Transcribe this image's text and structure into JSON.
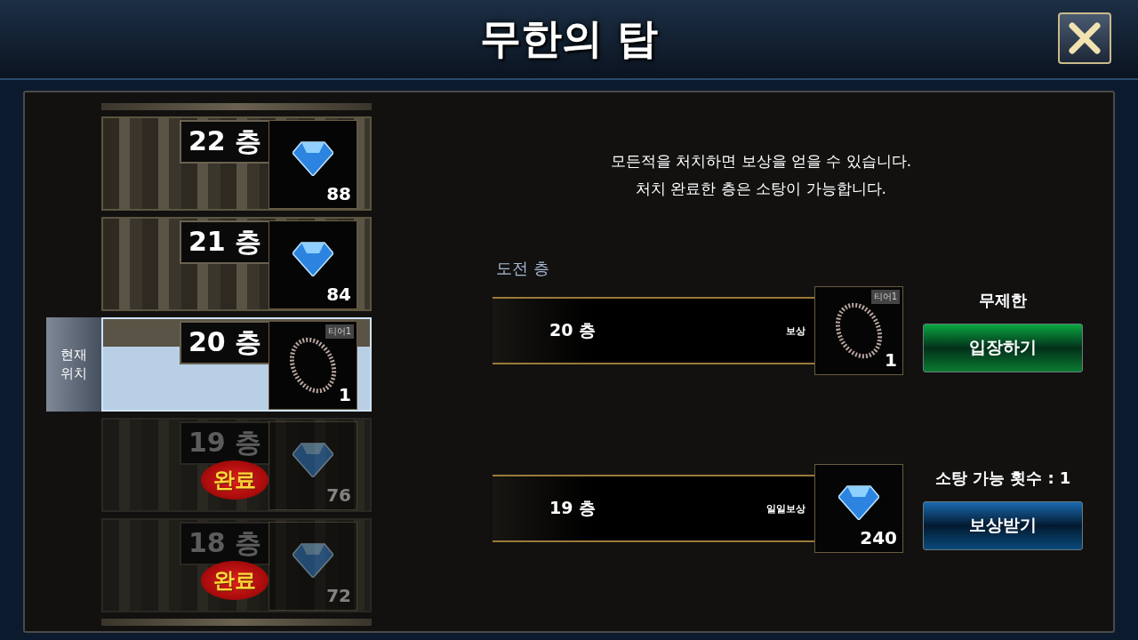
{
  "title": "무한의 탑",
  "floors": [
    {
      "label": "22 층",
      "current": false,
      "completed": false,
      "reward": {
        "kind": "gem",
        "count": "88"
      }
    },
    {
      "label": "21 층",
      "current": false,
      "completed": false,
      "reward": {
        "kind": "gem",
        "count": "84"
      }
    },
    {
      "label": "20 층",
      "current": true,
      "completed": false,
      "current_label": "현재 위치",
      "reward": {
        "kind": "necklace",
        "tier": "티어1",
        "count": "1"
      }
    },
    {
      "label": "19 층",
      "current": false,
      "completed": true,
      "badge": "완료",
      "reward": {
        "kind": "gem",
        "count": "76"
      }
    },
    {
      "label": "18 층",
      "current": false,
      "completed": true,
      "badge": "완료",
      "reward": {
        "kind": "gem",
        "count": "72"
      }
    }
  ],
  "description": [
    "모든적을 처치하면 보상을 얻을 수 있습니다.",
    "처치 완료한 층은 소탕이 가능합니다."
  ],
  "challenge_heading": "도전 층",
  "entries": [
    {
      "floor": "20 층",
      "reward_label": "보상",
      "reward": {
        "kind": "necklace",
        "tier": "티어1",
        "count": "1"
      },
      "note": "무제한",
      "button": {
        "label": "입장하기",
        "kind": "enter"
      }
    },
    {
      "floor": "19 층",
      "reward_label": "일일보상",
      "reward": {
        "kind": "gem",
        "count": "240"
      },
      "note": "소탕 가능 횟수 : 1",
      "button": {
        "label": "보상받기",
        "kind": "claim"
      }
    }
  ]
}
